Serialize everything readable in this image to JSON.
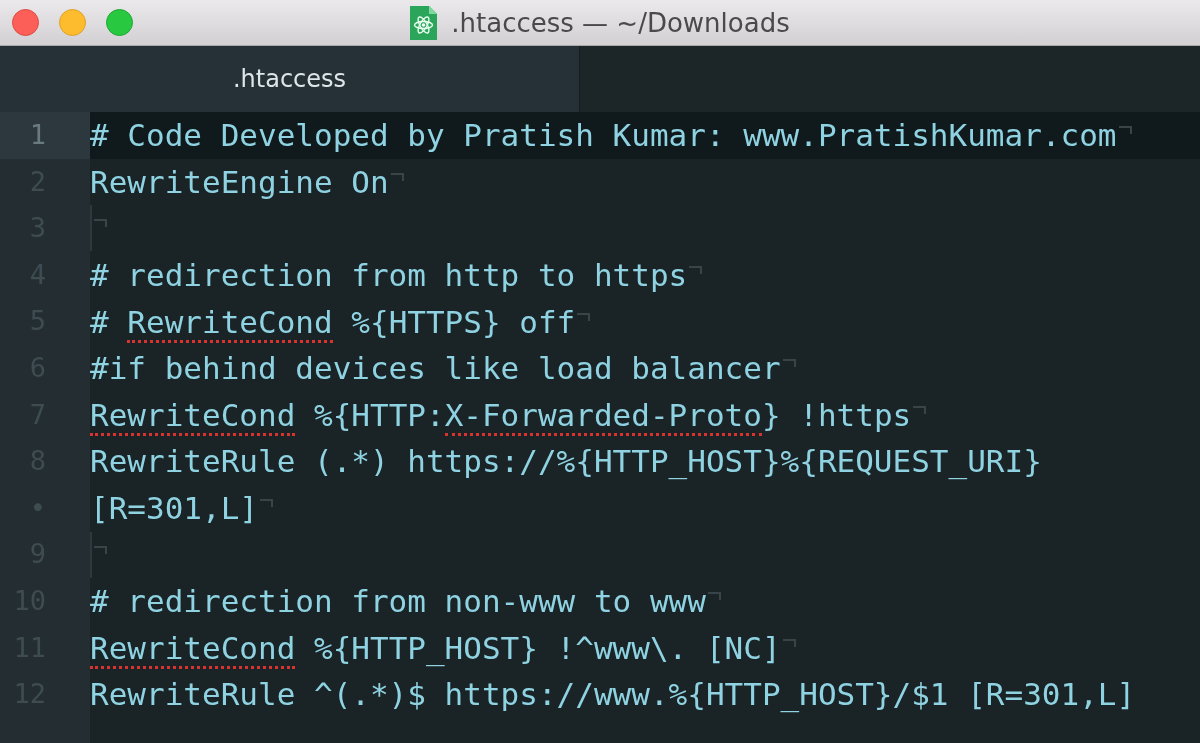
{
  "window": {
    "title": ".htaccess — ~/Downloads"
  },
  "tabs": [
    {
      "label": ".htaccess",
      "selected": true
    }
  ],
  "editor": {
    "wrap_marker": "•",
    "lines": [
      {
        "number": "1",
        "current": true,
        "eol_marker": true,
        "indent_guide": false,
        "segments": [
          {
            "text": "# Code Developed by Pratish Kumar: www.PratishKumar.com",
            "misspelled": false
          }
        ]
      },
      {
        "number": "2",
        "current": false,
        "eol_marker": true,
        "indent_guide": false,
        "segments": [
          {
            "text": "RewriteEngine On",
            "misspelled": false
          }
        ]
      },
      {
        "number": "3",
        "current": false,
        "eol_marker": true,
        "indent_guide": true
      },
      {
        "number": "4",
        "current": false,
        "eol_marker": true,
        "indent_guide": false,
        "segments": [
          {
            "text": "# redirection from http to https",
            "misspelled": false
          }
        ]
      },
      {
        "number": "5",
        "current": false,
        "eol_marker": true,
        "indent_guide": false,
        "segments": [
          {
            "text": "# ",
            "misspelled": false
          },
          {
            "text": "RewriteCond",
            "misspelled": true
          },
          {
            "text": " %{HTTPS} off",
            "misspelled": false
          }
        ]
      },
      {
        "number": "6",
        "current": false,
        "eol_marker": true,
        "indent_guide": false,
        "segments": [
          {
            "text": "#if behind devices like load balancer",
            "misspelled": false
          }
        ]
      },
      {
        "number": "7",
        "current": false,
        "eol_marker": true,
        "indent_guide": false,
        "segments": [
          {
            "text": "RewriteCond",
            "misspelled": true
          },
          {
            "text": " %{HTTP:",
            "misspelled": false
          },
          {
            "text": "X-Forwarded-Proto",
            "misspelled": true
          },
          {
            "text": "} !https",
            "misspelled": false
          }
        ]
      },
      {
        "number": "8",
        "current": false,
        "eol_marker": true,
        "indent_guide": false,
        "segments": [
          {
            "text": "RewriteRule (.*) https://%{HTTP_HOST}%{REQUEST_URI}",
            "misspelled": false
          }
        ],
        "wrap": [
          {
            "text": "[R=301,L]",
            "misspelled": false
          }
        ]
      },
      {
        "number": "9",
        "current": false,
        "eol_marker": true,
        "indent_guide": true
      },
      {
        "number": "10",
        "current": false,
        "eol_marker": true,
        "indent_guide": false,
        "segments": [
          {
            "text": "# redirection from non-www to www",
            "misspelled": false
          }
        ]
      },
      {
        "number": "11",
        "current": false,
        "eol_marker": true,
        "indent_guide": false,
        "segments": [
          {
            "text": "RewriteCond",
            "misspelled": true
          },
          {
            "text": " %{HTTP_HOST} !^www\\. [NC]",
            "misspelled": false
          }
        ]
      },
      {
        "number": "12",
        "current": false,
        "eol_marker": false,
        "indent_guide": false,
        "segments": [
          {
            "text": "RewriteRule ^(.*)$ https://www.%{HTTP_HOST}/$1 [R=301,L]",
            "misspelled": false
          }
        ]
      }
    ]
  }
}
